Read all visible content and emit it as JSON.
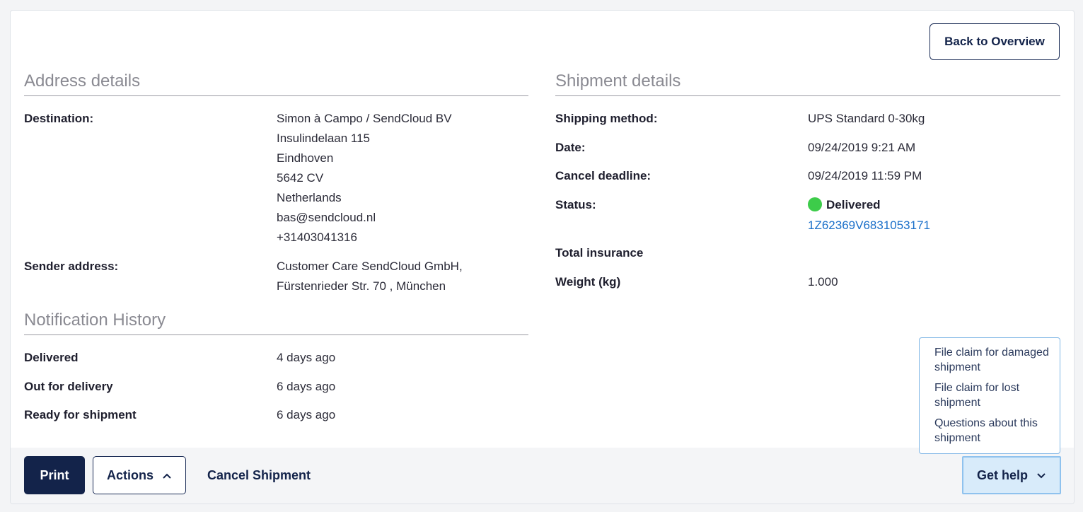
{
  "header": {
    "back_label": "Back to Overview"
  },
  "address": {
    "title": "Address details",
    "destination_label": "Destination:",
    "destination_lines": [
      "Simon à Campo / SendCloud BV",
      "Insulindelaan 115",
      "Eindhoven",
      "5642 CV",
      "Netherlands",
      "bas@sendcloud.nl",
      "+31403041316"
    ],
    "sender_label": "Sender address:",
    "sender_lines": [
      "Customer Care SendCloud GmbH,",
      "Fürstenrieder Str. 70 , München"
    ]
  },
  "notifications": {
    "title": "Notification History",
    "items": [
      {
        "label": "Delivered",
        "when": "4 days ago"
      },
      {
        "label": "Out for delivery",
        "when": "6 days ago"
      },
      {
        "label": "Ready for shipment",
        "when": "6 days ago"
      }
    ]
  },
  "shipment": {
    "title": "Shipment details",
    "method_label": "Shipping method:",
    "method_value": "UPS Standard 0-30kg",
    "date_label": "Date:",
    "date_value": "09/24/2019 9:21 AM",
    "deadline_label": "Cancel deadline:",
    "deadline_value": "09/24/2019 11:59 PM",
    "status_label": "Status:",
    "status_value": "Delivered",
    "status_color": "#3dcc4a",
    "tracking_number": "1Z62369V6831053171",
    "insurance_label": "Total insurance",
    "weight_label": "Weight (kg)",
    "weight_value": "1.000"
  },
  "help_menu": {
    "items": [
      "File claim for damaged shipment",
      "File claim for lost shipment",
      "Questions about this shipment"
    ]
  },
  "footer": {
    "print_label": "Print",
    "actions_label": "Actions",
    "cancel_label": "Cancel Shipment",
    "help_label": "Get help"
  },
  "colors": {
    "primary": "#13234a",
    "link": "#1a6fc9",
    "help_bg": "#d8ebfa"
  }
}
